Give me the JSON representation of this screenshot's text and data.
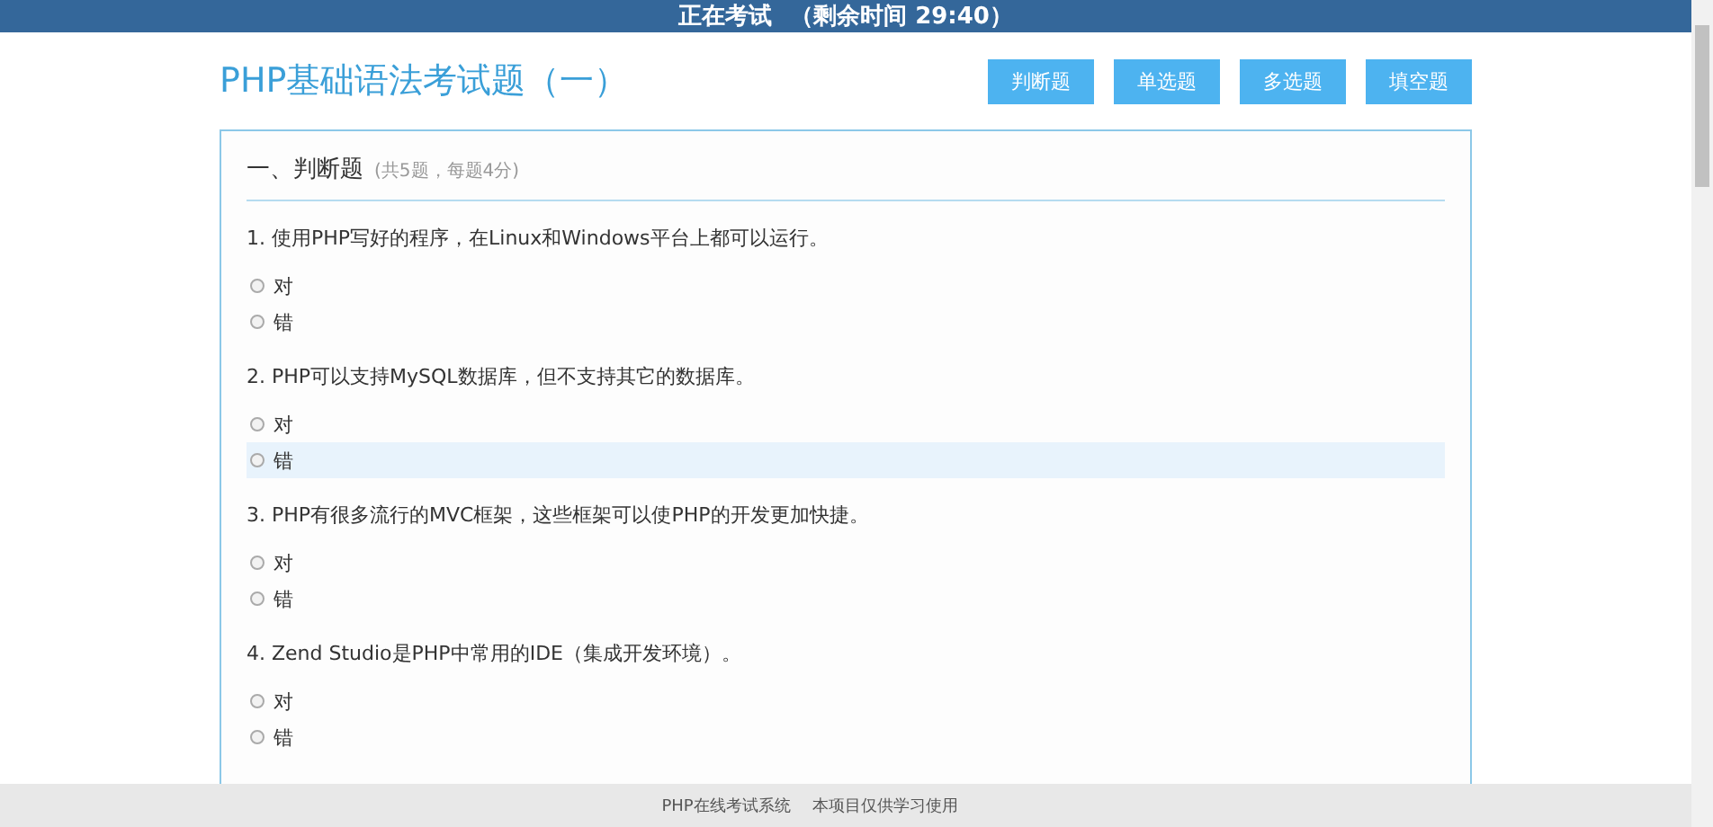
{
  "header": {
    "title": "正在考试",
    "timer": "（剩余时间 29:40）"
  },
  "exam": {
    "title": "PHP基础语法考试题（一）"
  },
  "nav_buttons": [
    {
      "label": "判断题"
    },
    {
      "label": "单选题"
    },
    {
      "label": "多选题"
    },
    {
      "label": "填空题"
    }
  ],
  "section": {
    "title": "一、判断题",
    "note": "(共5题，每题4分)"
  },
  "questions": [
    {
      "text": "1. 使用PHP写好的程序，在Linux和Windows平台上都可以运行。",
      "options": [
        {
          "label": "对",
          "checked": false,
          "highlighted": false
        },
        {
          "label": "错",
          "checked": false,
          "highlighted": false
        }
      ]
    },
    {
      "text": "2. PHP可以支持MySQL数据库，但不支持其它的数据库。",
      "options": [
        {
          "label": "对",
          "checked": false,
          "highlighted": false
        },
        {
          "label": "错",
          "checked": false,
          "highlighted": true
        }
      ]
    },
    {
      "text": "3. PHP有很多流行的MVC框架，这些框架可以使PHP的开发更加快捷。",
      "options": [
        {
          "label": "对",
          "checked": false,
          "highlighted": false
        },
        {
          "label": "错",
          "checked": false,
          "highlighted": false
        }
      ]
    },
    {
      "text": "4. Zend Studio是PHP中常用的IDE（集成开发环境）。",
      "options": [
        {
          "label": "对",
          "checked": false,
          "highlighted": false
        },
        {
          "label": "错",
          "checked": false,
          "highlighted": false
        }
      ]
    }
  ],
  "footer": {
    "items": [
      "PHP在线考试系统",
      "本项目仅供学习使用"
    ]
  }
}
